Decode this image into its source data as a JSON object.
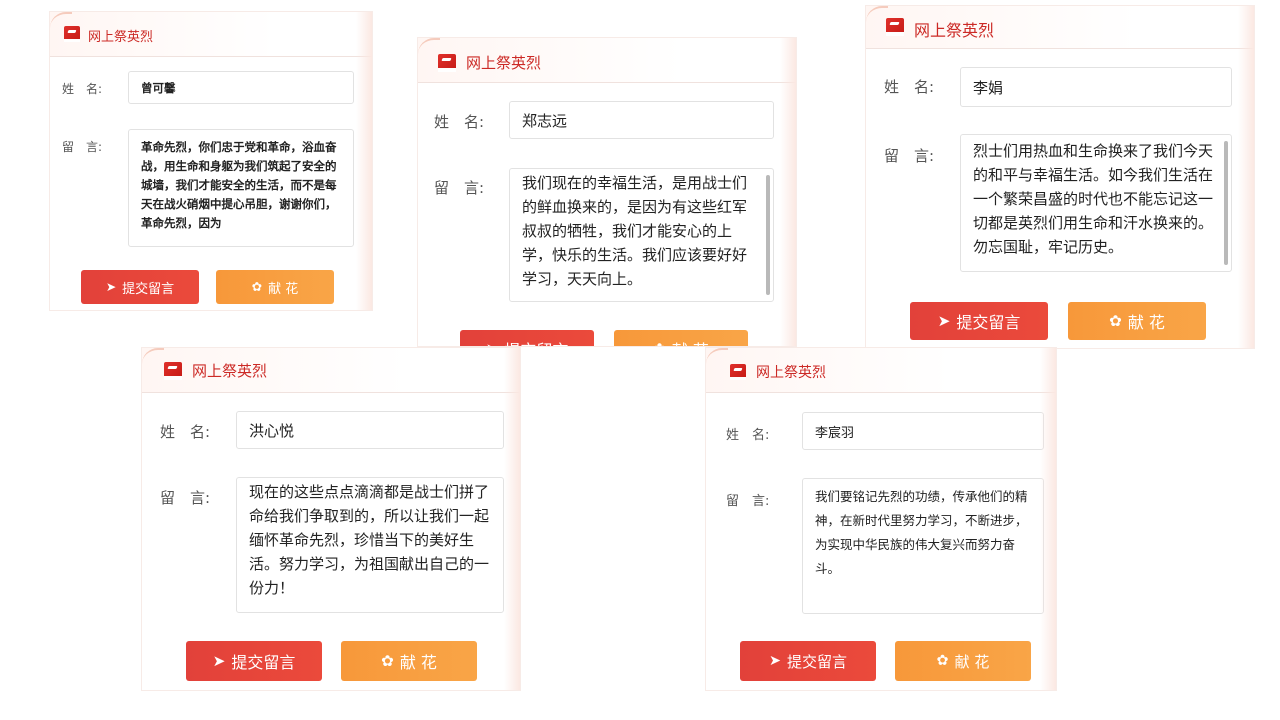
{
  "cards": [
    {
      "title": "网上祭英烈",
      "name_label": "姓　名:",
      "message_label": "留　言:",
      "name_value": "曾可馨",
      "message_value": "革命先烈，你们忠于党和革命，浴血奋战，用生命和身躯为我们筑起了安全的城墙，我们才能安全的生活，而不是每天在战火硝烟中提心吊胆，谢谢你们，革命先烈，因为",
      "submit_label": "提交留言",
      "flower_label": "献 花"
    },
    {
      "title": "网上祭英烈",
      "name_label": "姓　名:",
      "message_label": "留　言:",
      "name_value": "郑志远",
      "message_value": "我们现在的幸福生活，是用战士们的鲜血换来的，是因为有这些红军叔叔的牺牲，我们才能安心的上学，快乐的生活。我们应该要好好学习，天天向上。",
      "submit_label": "提交留言",
      "flower_label": "献 花"
    },
    {
      "title": "网上祭英烈",
      "name_label": "姓　名:",
      "message_label": "留　言:",
      "name_value": "李娟",
      "message_value": "烈士们用热血和生命换来了我们今天的和平与幸福生活。如今我们生活在一个繁荣昌盛的时代也不能忘记这一切都是英烈们用生命和汗水换来的。勿忘国耻，牢记历史。",
      "submit_label": "提交留言",
      "flower_label": "献 花"
    },
    {
      "title": "网上祭英烈",
      "name_label": "姓　名:",
      "message_label": "留　言:",
      "name_value": "洪心悦",
      "message_value": "现在的这些点点滴滴都是战士们拼了命给我们争取到的，所以让我们一起缅怀革命先烈，珍惜当下的美好生活。努力学习，为祖国献出自己的一份力！",
      "submit_label": "提交留言",
      "flower_label": "献 花"
    },
    {
      "title": "网上祭英烈",
      "name_label": "姓　名:",
      "message_label": "留　言:",
      "name_value": "李宸羽",
      "message_value": "我们要铭记先烈的功绩，传承他们的精神，在新时代里努力学习，不断进步，为实现中华民族的伟大复兴而努力奋斗。",
      "submit_label": "提交留言",
      "flower_label": "献 花"
    }
  ],
  "icons": {
    "logo": "memorial-book-icon",
    "submit": "paper-plane-icon",
    "flower": "flower-icon"
  },
  "colors": {
    "title_red": "#cc2a26",
    "submit_red": "#e2413a",
    "flower_orange": "#f7983a"
  }
}
